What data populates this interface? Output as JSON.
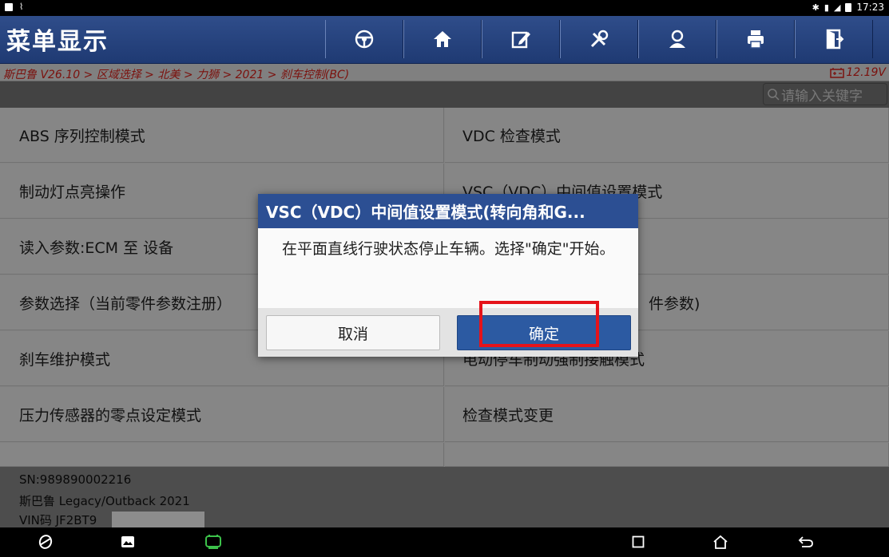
{
  "status_bar": {
    "time": "17:23"
  },
  "header": {
    "title": "菜单显示",
    "toolbar_icons": [
      "steering-wheel-icon",
      "home-icon",
      "edit-icon",
      "tools-icon",
      "user-icon",
      "print-icon",
      "exit-icon"
    ]
  },
  "breadcrumb": {
    "path": "斯巴鲁 V26.10 > 区域选择 > 北美 > 力狮 > 2021 > 刹车控制(BC)",
    "voltage": "12.19V"
  },
  "search": {
    "placeholder": "请输入关键字"
  },
  "menu": {
    "items": [
      "ABS 序列控制模式",
      "VDC 检查模式",
      "制动灯点亮操作",
      "VSC（VDC）中间值设置模式",
      "读入参数:ECM 至 设备",
      "",
      "参数选择（当前零件参数注册）",
      "件参数)",
      "刹车维护模式",
      "电动停车制动强制接触模式",
      "压力传感器的零点设定模式",
      "检查模式变更",
      "",
      ""
    ]
  },
  "info": {
    "sn": "SN:989890002216",
    "vehicle": "斯巴鲁 Legacy/Outback 2021",
    "vin": "VIN码 JF2BT9"
  },
  "dialog": {
    "title": "VSC（VDC）中间值设置模式(转向角和G...",
    "message": "在平面直线行驶状态停止车辆。选择\"确定\"开始。",
    "cancel_label": "取消",
    "ok_label": "确定"
  },
  "colors": {
    "header_bg": "#2f4d8a",
    "breadcrumb_text": "#e0211b",
    "dialog_title_bg": "#2c4f93",
    "ok_button_bg": "#2c5aa2",
    "highlight": "#e5131a"
  }
}
